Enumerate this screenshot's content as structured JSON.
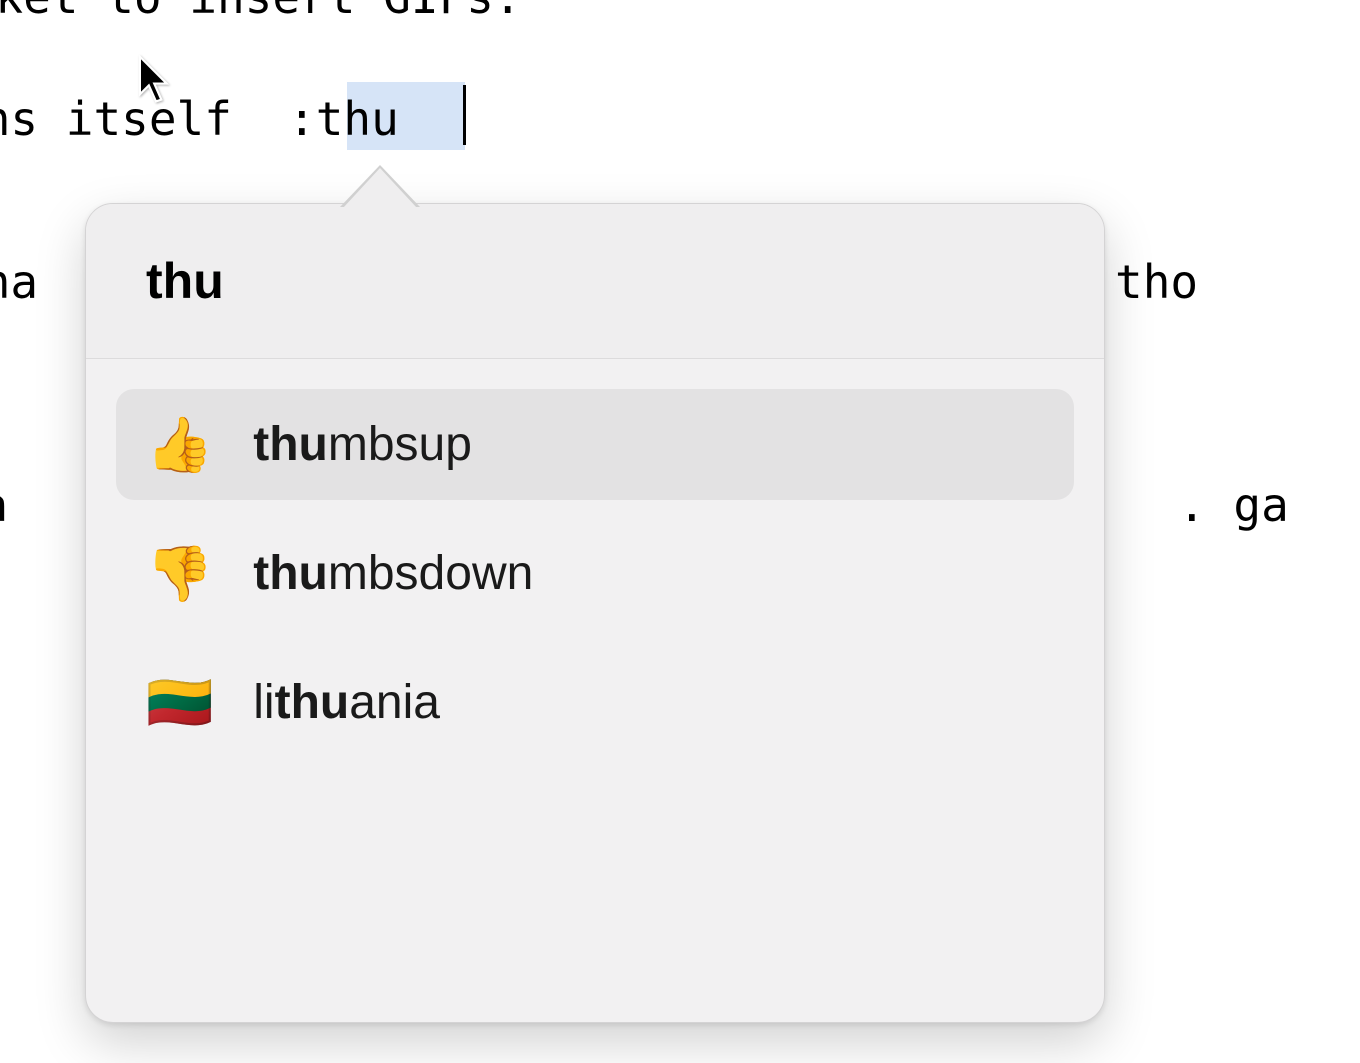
{
  "background": {
    "line0": "u still use Rocket to insert GIFs.",
    "line1": "rns itself",
    "line2a": " tha",
    "line2b": " tho",
    "line3a": "Sla",
    "line3b": ". ga"
  },
  "input": {
    "trigger": ":",
    "typed": "thu"
  },
  "picker": {
    "query": "thu",
    "suggestions": [
      {
        "emoji": "👍",
        "ariaLabel": "thumbs up emoji",
        "prefix": "",
        "match": "thu",
        "suffix": "mbsup",
        "selected": true
      },
      {
        "emoji": "👎",
        "ariaLabel": "thumbs down emoji",
        "prefix": "",
        "match": "thu",
        "suffix": "mbsdown",
        "selected": false
      },
      {
        "emoji": "🇱🇹",
        "ariaLabel": "lithuania flag emoji",
        "prefix": "li",
        "match": "thu",
        "suffix": "ania",
        "selected": false
      }
    ]
  }
}
